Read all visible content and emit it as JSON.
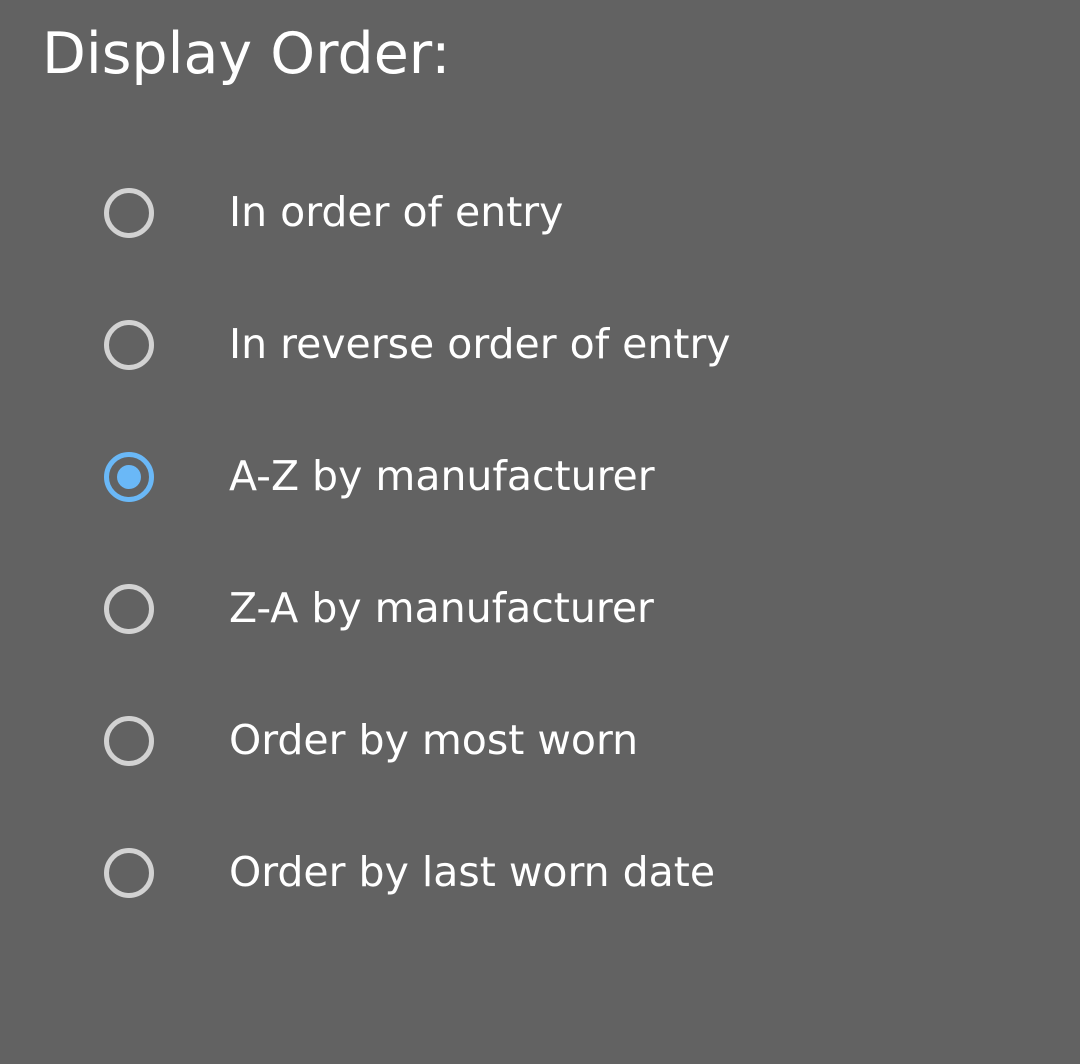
{
  "dialog": {
    "title": "Display Order:"
  },
  "options": [
    {
      "label": "In order of entry",
      "selected": false
    },
    {
      "label": "In reverse order of entry",
      "selected": false
    },
    {
      "label": "A-Z by manufacturer",
      "selected": true
    },
    {
      "label": "Z-A by manufacturer",
      "selected": false
    },
    {
      "label": "Order by most worn",
      "selected": false
    },
    {
      "label": "Order by last worn date",
      "selected": false
    }
  ],
  "colors": {
    "background": "#626262",
    "text": "#ffffff",
    "radio_unselected": "#d2d2d2",
    "radio_selected": "#6ab8f7"
  },
  "icons": {
    "unselected": "radio-unchecked-icon",
    "selected": "radio-checked-icon"
  }
}
